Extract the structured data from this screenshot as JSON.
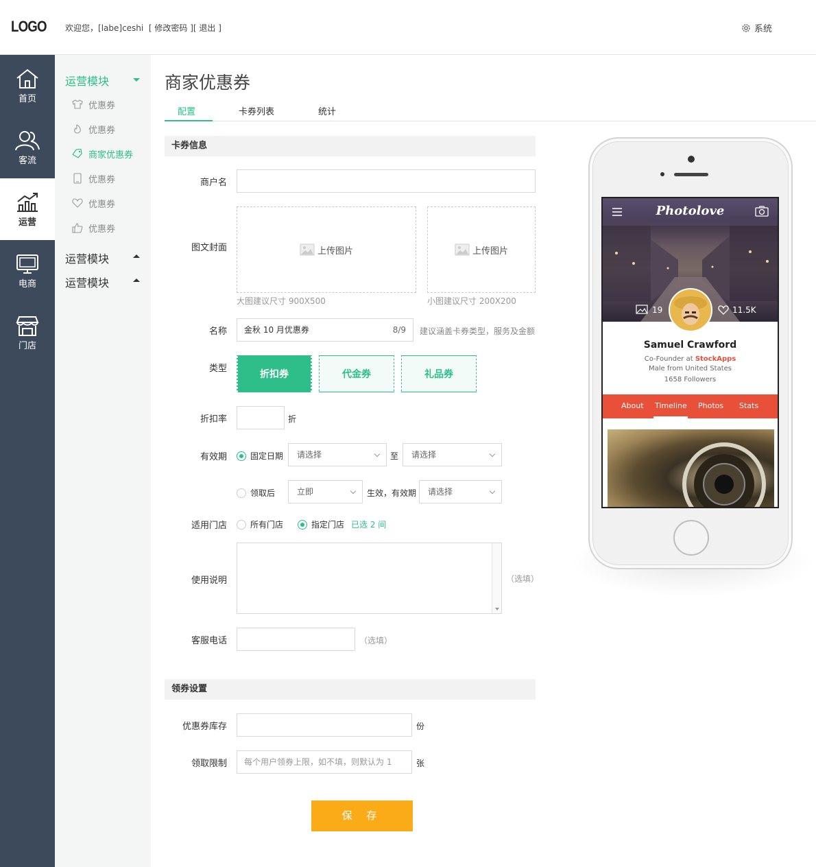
{
  "header": {
    "logo": "LOGO",
    "welcome_prefix": "欢迎您，",
    "username": "[labe]ceshi",
    "change_password": "[ 修改密码 ]",
    "logout": "[ 退出 ]",
    "system_label": "系统"
  },
  "main_nav": [
    {
      "label": "首页",
      "icon": "home-icon"
    },
    {
      "label": "客流",
      "icon": "users-icon"
    },
    {
      "label": "运营",
      "icon": "chart-icon",
      "active": true
    },
    {
      "label": "电商",
      "icon": "monitor-icon"
    },
    {
      "label": "门店",
      "icon": "store-icon"
    }
  ],
  "sub_nav": {
    "group1_label": "运营模块",
    "items": [
      {
        "label": "优惠券",
        "icon": "shirt-icon"
      },
      {
        "label": "优惠券",
        "icon": "fire-icon"
      },
      {
        "label": "商家优惠券",
        "icon": "tag-icon",
        "active": true
      },
      {
        "label": "优惠券",
        "icon": "phone-icon"
      },
      {
        "label": "优惠券",
        "icon": "heart-icon"
      },
      {
        "label": "优惠券",
        "icon": "thumbs-up-icon"
      }
    ],
    "group2_label": "运营模块",
    "group3_label": "运营模块"
  },
  "page": {
    "title": "商家优惠券",
    "tabs": [
      "配置",
      "卡券列表",
      "统计"
    ],
    "active_tab": "配置"
  },
  "form": {
    "section1": "卡券信息",
    "merchant_label": "商户名",
    "merchant_value": "",
    "cover_label": "图文封面",
    "upload_label": "上传图片",
    "large_hint": "大图建议尺寸 900X500",
    "small_hint": "小图建议尺寸 200X200",
    "name_label": "名称",
    "name_value": "金秋 10 月优惠券",
    "name_count": "8/9",
    "name_hint": "建议涵盖卡券类型，服务及金额",
    "type_label": "类型",
    "types": [
      "折扣券",
      "代金券",
      "礼品券"
    ],
    "selected_type": "折扣券",
    "discount_label": "折扣率",
    "discount_value": "",
    "discount_unit": "折",
    "validity_label": "有效期",
    "fixed_date_label": "固定日期",
    "select_placeholder": "请选择",
    "to_label": "至",
    "after_receive_label": "领取后",
    "immediate_value": "立即",
    "effective_text": "生效，有效期",
    "store_label": "适用门店",
    "all_stores": "所有门店",
    "specified_stores": "指定门店",
    "selected_count": "已选 2 间",
    "usage_label": "使用说明",
    "optional": "（选填）",
    "phone_label": "客服电话",
    "section2": "领券设置",
    "stock_label": "优惠券库存",
    "stock_unit": "份",
    "limit_label": "领取限制",
    "limit_placeholder": "每个用户领券上限，如不填，则默认为 1",
    "limit_unit": "张",
    "save_label": "保 存"
  },
  "preview": {
    "app_name": "Photolove",
    "photos_count": "19",
    "likes_count": "11.5K",
    "profile_name": "Samuel Crawford",
    "role_prefix": "Co-Founder at ",
    "company": "StockApps",
    "location": "Male from United States",
    "followers": "1658 Followers",
    "tabs": [
      "About",
      "Timeline",
      "Photos",
      "Stats"
    ],
    "active_tab": "Timeline",
    "accent_color": "#e8503a"
  },
  "colors": {
    "primary": "#2dbe8a",
    "sidebar": "#3d4a5b",
    "save_button": "#fbab18"
  }
}
